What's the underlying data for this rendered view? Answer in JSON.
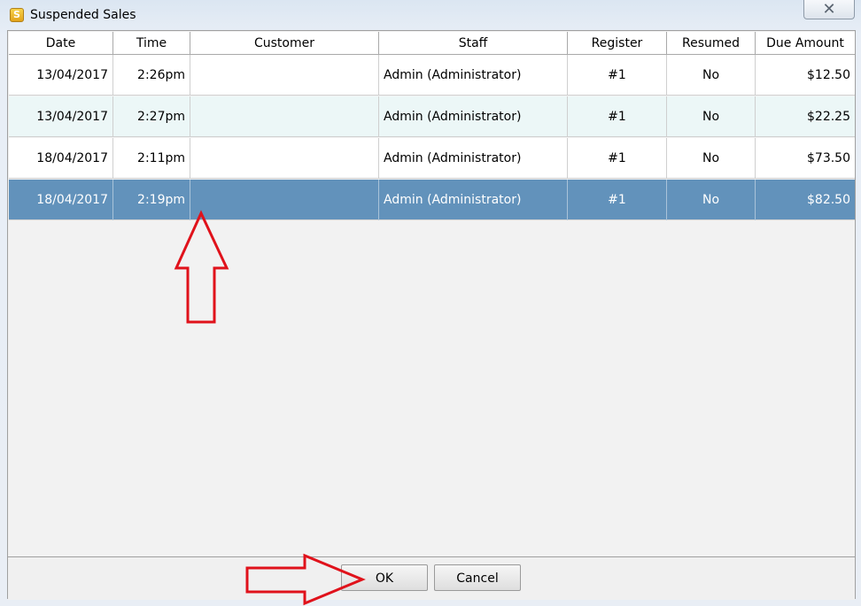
{
  "window": {
    "title": "Suspended Sales",
    "app_icon": "app-logo-icon",
    "close_glyph": "✕"
  },
  "table": {
    "columns": [
      "Date",
      "Time",
      "Customer",
      "Staff",
      "Register",
      "Resumed",
      "Due Amount"
    ],
    "rows": [
      {
        "date": "13/04/2017",
        "time": "2:26pm",
        "customer": "",
        "staff": "Admin (Administrator)",
        "register": "#1",
        "resumed": "No",
        "due": "$12.50"
      },
      {
        "date": "13/04/2017",
        "time": "2:27pm",
        "customer": "",
        "staff": "Admin (Administrator)",
        "register": "#1",
        "resumed": "No",
        "due": "$22.25"
      },
      {
        "date": "18/04/2017",
        "time": "2:11pm",
        "customer": "",
        "staff": "Admin (Administrator)",
        "register": "#1",
        "resumed": "No",
        "due": "$73.50"
      },
      {
        "date": "18/04/2017",
        "time": "2:19pm",
        "customer": "",
        "staff": "Admin (Administrator)",
        "register": "#1",
        "resumed": "No",
        "due": "$82.50"
      }
    ],
    "selected_row": 3
  },
  "buttons": {
    "ok": "OK",
    "cancel": "Cancel"
  },
  "colors": {
    "selection": "#6292bb",
    "alt_row": "#ecf7f7",
    "annotation_arrow": "#e0121b"
  }
}
